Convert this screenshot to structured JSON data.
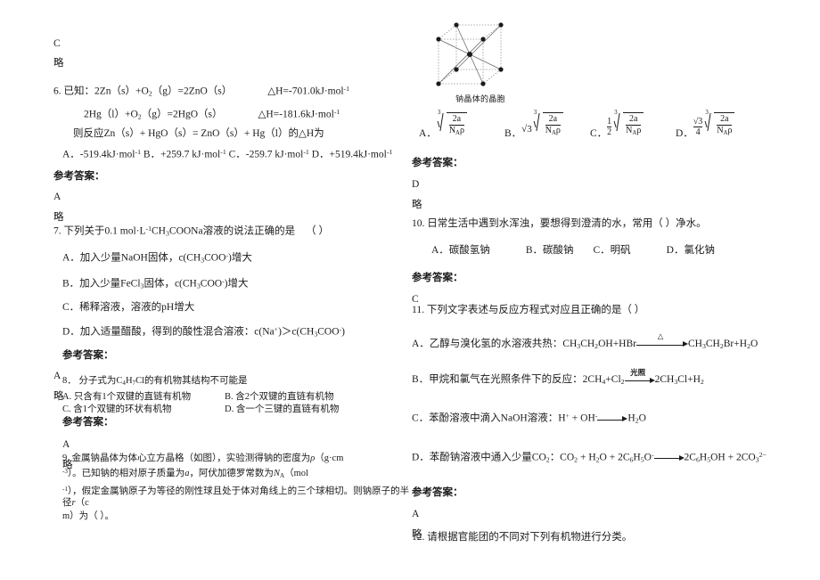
{
  "document": {
    "language": "zh-CN",
    "kind": "chemistry-exam-answer-sheet"
  },
  "left_column": {
    "orphan_answer": {
      "value": "C",
      "note": "略"
    },
    "q6": {
      "stem": "6. 已知：2Zn（s）+O",
      "stem_sub1": "2",
      "stem_mid": "（g）=2ZnO（s）",
      "dh1_label": "△H=-701.0kJ·mol",
      "dh1_sup": "-1",
      "line2_a": "2Hg（l）+O",
      "line2_sub": "2",
      "line2_b": "（g）=2HgO（s）",
      "dh2_label": "△H=-181.6kJ·mol",
      "dh2_sup": "-1",
      "line3": "则反应Zn（s）+ HgO（s）= ZnO（s）+ Hg（l）的△H为",
      "optA": "A．-519.4kJ·mol",
      "optA_sup": "-1",
      "optB": "B．+259.7 kJ·mol",
      "optB_sup": "-1",
      "optC": "C．-259.7 kJ·mol",
      "optC_sup": "-1",
      "optD": "D．+519.4kJ·mol",
      "optD_sup": "-1",
      "answer_label": "参考答案：",
      "answer_value": "A",
      "answer_note": "略"
    },
    "q7": {
      "stem_a": "7. 下列关于0.1 mol·L",
      "stem_sup": "-1",
      "stem_b": "CH",
      "stem_sub1": "3",
      "stem_c": "COONa溶液的说法正确的是",
      "stem_paren": "（  ）",
      "optA": {
        "label": "A．加入少量NaOH固体，c(CH",
        "sub1": "3",
        "mid": "COO",
        "sup": "-",
        "tail": ")增大"
      },
      "optB": {
        "label": "B．加入少量FeCl",
        "sub0": "3",
        "mid0": "固体，c(CH",
        "sub1": "3",
        "mid": "COO",
        "sup": "-",
        "tail": ")增大"
      },
      "optC": {
        "label": "C．稀释溶液，溶液的pH增大"
      },
      "optD": {
        "label": "D．加入适量醋酸，得到的酸性混合溶液：c(Na",
        "sup1": "+",
        "mid": ")＞c(CH",
        "sub1": "3",
        "mid2": "COO",
        "sup2": "-",
        "tail": ")"
      },
      "answer_label": "参考答案：",
      "answer_value": "A",
      "answer_note": "略"
    },
    "q8": {
      "stem_a": "8． 分子式为C",
      "stem_sub1": "4",
      "stem_b": "H",
      "stem_sub2": "7",
      "stem_c": "Cl的有机物其结构不可能是",
      "optA": "A. 只含有1个双键的直链有机物",
      "optB": "B. 含2个双键的直链有机物",
      "optC": "C. 含1个双键的环状有机物",
      "optD": "D. 含一个三键的直链有机物",
      "answer_label": "参考答案：",
      "answer_value": "A",
      "answer_note": "略"
    },
    "q9": {
      "line1_a": "9. 金属钠晶体为体心立方晶格（如图），实验测得钠的密度为",
      "line1_rho": "ρ",
      "line1_b": "（g·cm",
      "line2_sup": "-3",
      "line2_a": "）。已知钠的相对原子质量为",
      "line2_a_i": "a",
      "line2_b": "，阿伏加德罗常数为",
      "line2_b_i": "N",
      "line2_b_sub": "A",
      "line2_c": "（mol",
      "line3_sup": "-1",
      "line3_a": "），假定金属钠原子为等径的刚性球且处于体对角线上的三个球相切。则钠原子的半径",
      "line3_r": "r",
      "line3_b": "（c",
      "line4": "m）为（   ）。"
    }
  },
  "right_column": {
    "figure": {
      "caption": "钠晶体的晶胞",
      "type": "body-centered-cubic-unit-cell"
    },
    "q9_options": {
      "optA_label": "A．",
      "optA_index": "3",
      "optA_num": "2a",
      "optA_den_n": "N",
      "optA_den_sub": "A",
      "optA_den_rho": "ρ",
      "optB_label": "B．",
      "optB_coef": "√3",
      "optB_index": "3",
      "optB_num": "2a",
      "optB_den_n": "N",
      "optB_den_sub": "A",
      "optB_den_rho": "ρ",
      "optC_label": "C．",
      "optC_coef_top": "1",
      "optC_coef_bot": "2",
      "optC_index": "3",
      "optC_num": "2a",
      "optC_den_n": "N",
      "optC_den_sub": "A",
      "optC_den_rho": "ρ",
      "optD_label": "D．",
      "optD_coef_top": "√3",
      "optD_coef_bot": "4",
      "optD_index": "3",
      "optD_num": "2a",
      "optD_den_n": "N",
      "optD_den_sub": "A",
      "optD_den_rho": "ρ"
    },
    "q9_answer": {
      "label": "参考答案：",
      "value": "D",
      "note": "略"
    },
    "q10": {
      "stem": "10. 日常生活中遇到水浑浊，要想得到澄清的水，常用（    ）净水。",
      "optA": "A．碳酸氢钠",
      "optB": "B．碳酸钠",
      "optC": "C．明矾",
      "optD": "D．氯化钠",
      "answer_label": "参考答案：",
      "answer_value": "C"
    },
    "q11": {
      "stem": "11. 下列文字表述与反应方程式对应且正确的是（   ）",
      "optA": {
        "text": "A．乙醇与溴化氢的水溶液共热：CH",
        "sub1": "3",
        "t2": "CH",
        "sub2": "2",
        "t3": "OH+HBr",
        "arrow_above": "△",
        "t4": "CH",
        "sub3": "3",
        "t5": "CH",
        "sub4": "2",
        "t6": "Br+H",
        "sub5": "2",
        "t7": "O"
      },
      "optB": {
        "text": "B．甲烷和氯气在光照条件下的反应：2CH",
        "sub1": "4",
        "t2": "+Cl",
        "sub2": "2",
        "arrow_above": "光照",
        "t3": "2CH",
        "sub3": "3",
        "t4": "Cl+H",
        "sub4": "2"
      },
      "optC": {
        "text": "C．苯酚溶液中滴入NaOH溶液：H",
        "sup1": "+",
        "t2": " + OH",
        "sup2": "-",
        "t3": "H",
        "sub1": "2",
        "t4": "O"
      },
      "optD": {
        "text": "D．苯酚钠溶液中通入少量CO",
        "sub0": "2",
        "t1": "：CO",
        "sub1": "2",
        "t2": " + H",
        "sub2": "2",
        "t3": "O + 2C",
        "sub3": "6",
        "t4": "H",
        "sub4": "5",
        "t5": "O",
        "sup1": "-",
        "t6": "2C",
        "sub5": "6",
        "t7": "H",
        "sub6": "5",
        "t8": "OH + 2CO",
        "sub7": "3",
        "sup2": "2−"
      },
      "answer_label": "参考答案：",
      "answer_value": "A",
      "answer_note": "略"
    },
    "q12": {
      "stem": "12. 请根据官能团的不同对下列有机物进行分类。"
    }
  }
}
